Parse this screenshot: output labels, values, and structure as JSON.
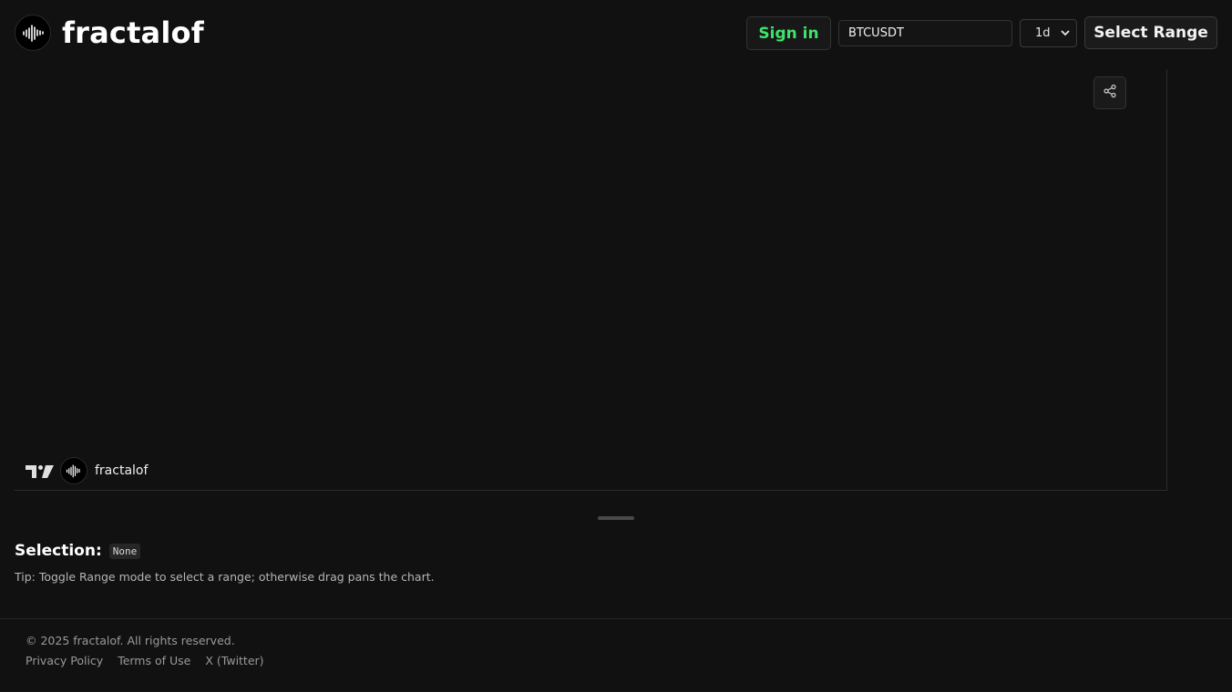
{
  "brand": {
    "name": "fractalof",
    "logo_icon": "waveform-logo-icon"
  },
  "header": {
    "signin_label": "Sign in",
    "signin_color": "#3ee36b",
    "symbol_value": "BTCUSDT",
    "interval_selected": "1d",
    "range_label": "Select Range"
  },
  "chart": {
    "share_icon": "share-icon",
    "attribution_icon": "tradingview-logo-icon",
    "attribution_name": "fractalof"
  },
  "selection": {
    "label": "Selection:",
    "value": "None",
    "tip": "Tip: Toggle Range mode to select a range; otherwise drag pans the chart."
  },
  "footer": {
    "copyright": "© 2025 fractalof. All rights reserved.",
    "links": [
      "Privacy Policy",
      "Terms of Use",
      "X (Twitter)"
    ]
  }
}
